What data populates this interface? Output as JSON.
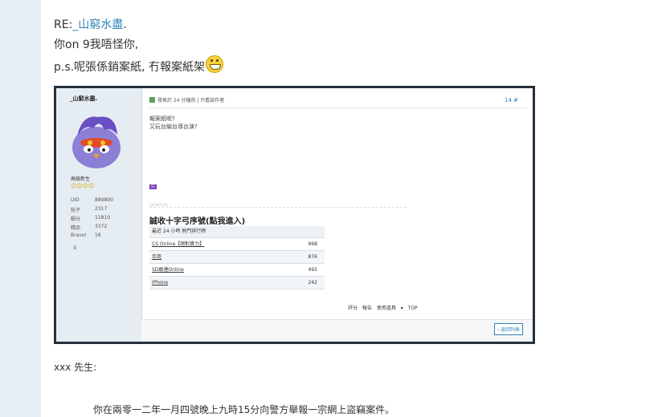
{
  "post": {
    "reply_prefix": "RE:",
    "reply_user": "_山窮水盡",
    "reply_suffix": ".",
    "line2": "你on 9我唔怪你,",
    "line3": "p.s.呢張係銷案紙, 冇報案紙架",
    "smiley": "grin-icon"
  },
  "embedded": {
    "username": "_山窮水盡.",
    "rank": "高級新生",
    "medals": "☺☺☺☺",
    "stats": [
      {
        "label": "UID",
        "value": "889890"
      },
      {
        "label": "帖子",
        "value": "2317"
      },
      {
        "label": "積分",
        "value": "11810"
      },
      {
        "label": "精品",
        "value": "3372"
      },
      {
        "label": "Bravo!",
        "value": "16"
      }
    ],
    "trophy": "♛",
    "meta": "發表於 24 分鐘前 | 只看該作者",
    "floor": "14 #",
    "message_line1": "報案紙呢?",
    "message_line2": "又玩台編台導台演?",
    "tag": "S1",
    "signature_label": "SIGNATURE",
    "signature_title": "誠收十字弓序號(點我進入)",
    "table_head": "最近 24 小時 熱門排行榜",
    "table_rows": [
      {
        "name": "CS Online【絕對實力】",
        "value": "968"
      },
      {
        "name": "巨商",
        "value": "876"
      },
      {
        "name": "SD敢達Online",
        "value": "493"
      },
      {
        "name": "iPhone",
        "value": "242"
      }
    ],
    "actions": "評分 報告 使用道具 ▾ TOP",
    "back_button": "‹ 返回列表"
  },
  "after": {
    "line1": "xxx 先生:",
    "line2": "你在兩零一二年一月四號晚上九時15分向警方舉報一宗網上盜竊案件。"
  }
}
